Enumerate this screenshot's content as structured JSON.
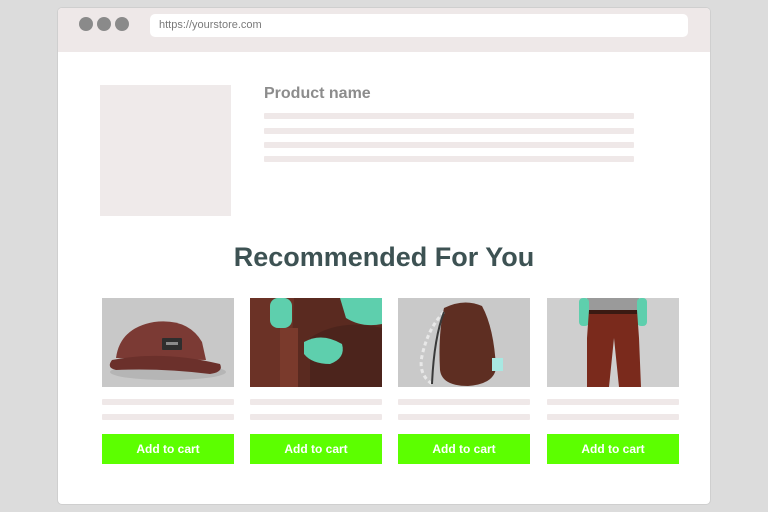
{
  "browser": {
    "url": "https://yourstore.com"
  },
  "product": {
    "name": "Product name"
  },
  "recommendations": {
    "title": "Recommended For You",
    "items": [
      {
        "image": "red-cap-photo",
        "button_label": "Add to cart"
      },
      {
        "image": "shirt-sleeve-photo",
        "button_label": "Add to cart"
      },
      {
        "image": "brown-drawstring-bag-photo",
        "button_label": "Add to cart"
      },
      {
        "image": "red-trousers-photo",
        "button_label": "Add to cart"
      }
    ]
  },
  "colors": {
    "accent_button": "#5cff00",
    "heading": "#3d5253",
    "placeholder": "#efe8e8",
    "titlebar": "#eee8e8"
  }
}
